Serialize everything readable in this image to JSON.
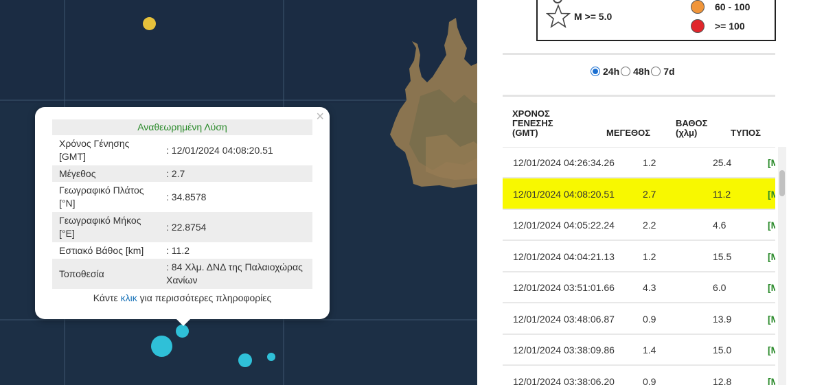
{
  "popup": {
    "title": "Αναθεωρημένη Λύση",
    "close": "×",
    "fields": [
      {
        "label": "Χρόνος Γένησης [GMT]",
        "value": ": 12/01/2024 04:08:20.51"
      },
      {
        "label": "Μέγεθος",
        "value": ": 2.7"
      },
      {
        "label": "Γεωγραφικό Πλάτος [°N]",
        "value": ": 34.8578"
      },
      {
        "label": "Γεωγραφικό Μήκος [°E]",
        "value": ": 22.8754"
      },
      {
        "label": "Εστιακό Βάθος [km]",
        "value": ": 11.2"
      },
      {
        "label": "Τοποθεσία",
        "value": ": 84 Χλμ. ΔΝΔ της Παλαιοχώρας Χανίων"
      }
    ],
    "more_prefix": "Κάντε ",
    "more_link": "κλικ",
    "more_suffix": " για περισσότερες πληροφορίες"
  },
  "legend": {
    "magnitude_label": "M >= 5.0",
    "depth_items": [
      {
        "label": "60 - 100",
        "color": "#f0953a"
      },
      {
        "label": ">= 100",
        "color": "#e0262b"
      }
    ]
  },
  "period": {
    "options": [
      "24h",
      "48h",
      "7d"
    ],
    "selected": "24h"
  },
  "table": {
    "headers": {
      "time": [
        "ΧΡΟΝΟΣ",
        "ΓΕΝΕΣΗΣ",
        "(GMT)"
      ],
      "magnitude": "ΜΕΓΕΘΟΣ",
      "depth": [
        "ΒΑΘΟΣ",
        "(χλμ)"
      ],
      "type": "ΤΥΠΟΣ"
    },
    "rows": [
      {
        "time": "12/01/2024 04:26:34.26",
        "mag": "1.2",
        "depth": "25.4",
        "type": "[M",
        "highlight": false
      },
      {
        "time": "12/01/2024 04:08:20.51",
        "mag": "2.7",
        "depth": "11.2",
        "type": "[M",
        "highlight": true
      },
      {
        "time": "12/01/2024 04:05:22.24",
        "mag": "2.2",
        "depth": "4.6",
        "type": "[M",
        "highlight": false
      },
      {
        "time": "12/01/2024 04:04:21.13",
        "mag": "1.2",
        "depth": "15.5",
        "type": "[M",
        "highlight": false
      },
      {
        "time": "12/01/2024 03:51:01.66",
        "mag": "4.3",
        "depth": "6.0",
        "type": "[M",
        "highlight": false
      },
      {
        "time": "12/01/2024 03:48:06.87",
        "mag": "0.9",
        "depth": "13.9",
        "type": "[M",
        "highlight": false
      },
      {
        "time": "12/01/2024 03:38:09.86",
        "mag": "1.4",
        "depth": "15.0",
        "type": "[M",
        "highlight": false
      },
      {
        "time": "12/01/2024 03:38:06.20",
        "mag": "0.9",
        "depth": "12.8",
        "type": "[M",
        "highlight": false
      }
    ]
  },
  "colors": {
    "highlight_row": "#f8f800",
    "quake_shallow": "#2fc0d8",
    "quake_mid": "#e8c23a",
    "title_green": "#2a8a2a"
  }
}
